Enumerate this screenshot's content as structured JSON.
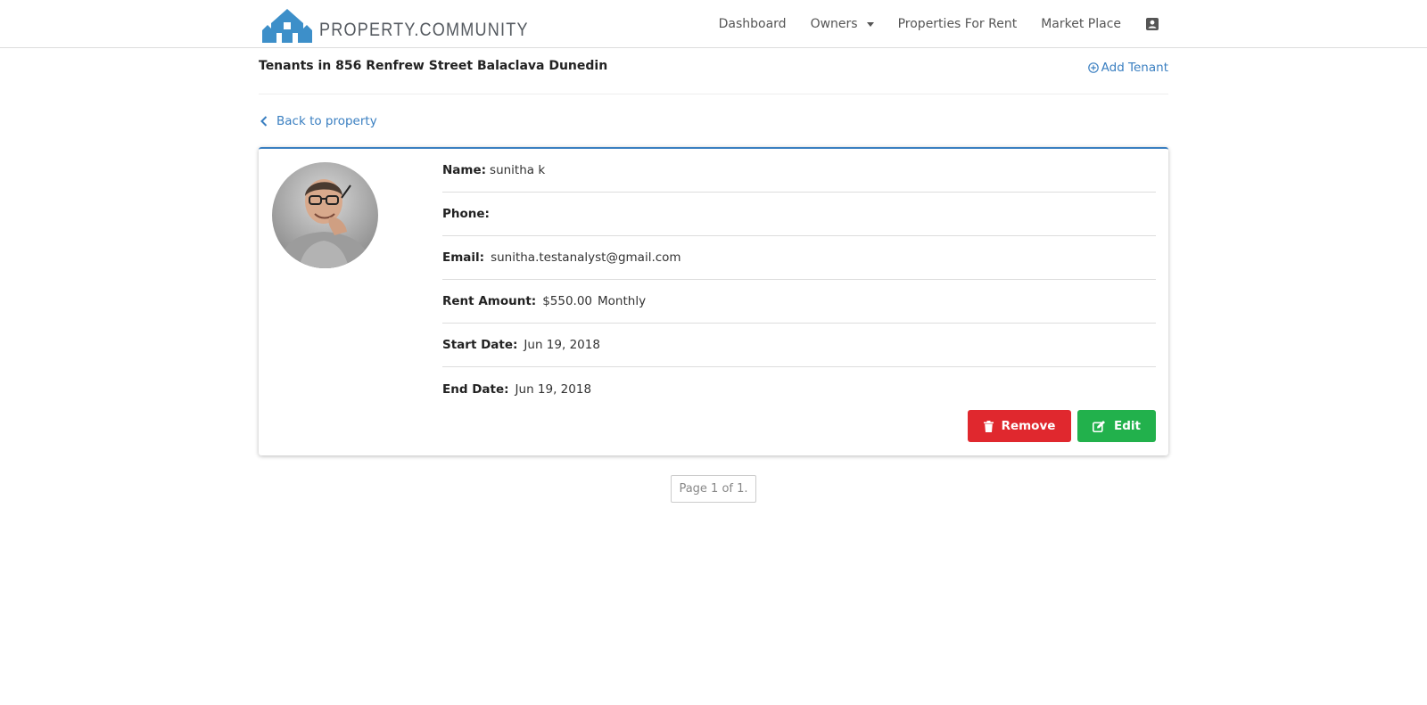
{
  "brand": {
    "name": "PROPERTY.COMMUNITY",
    "logo_color": "#3d8fc9"
  },
  "nav": {
    "dashboard": "Dashboard",
    "owners": "Owners",
    "properties_for_rent": "Properties For Rent",
    "market_place": "Market Place",
    "profile_icon": "contact-card-icon"
  },
  "header": {
    "title": "Tenants in 856 Renfrew Street Balaclava Dunedin",
    "add_tenant": "Add Tenant"
  },
  "back_link": "Back to property",
  "tenant": {
    "avatar_icon": "person-photo",
    "name_label": "Name:",
    "name": "sunitha k",
    "phone_label": "Phone:",
    "phone": "",
    "email_label": "Email:",
    "email": "sunitha.testanalyst@gmail.com",
    "rent_label": "Rent Amount:",
    "rent_amount": "$550.00",
    "rent_frequency": "Monthly",
    "start_label": "Start Date:",
    "start_date": "Jun 19, 2018",
    "end_label": "End Date:",
    "end_date": "Jun 19, 2018"
  },
  "actions": {
    "remove": "Remove",
    "edit": "Edit",
    "remove_color": "#e0282e",
    "edit_color": "#22b14c"
  },
  "pagination": "Page 1 of 1.",
  "colors": {
    "link": "#3a7fc1",
    "card_accent": "#3a7fc1"
  }
}
